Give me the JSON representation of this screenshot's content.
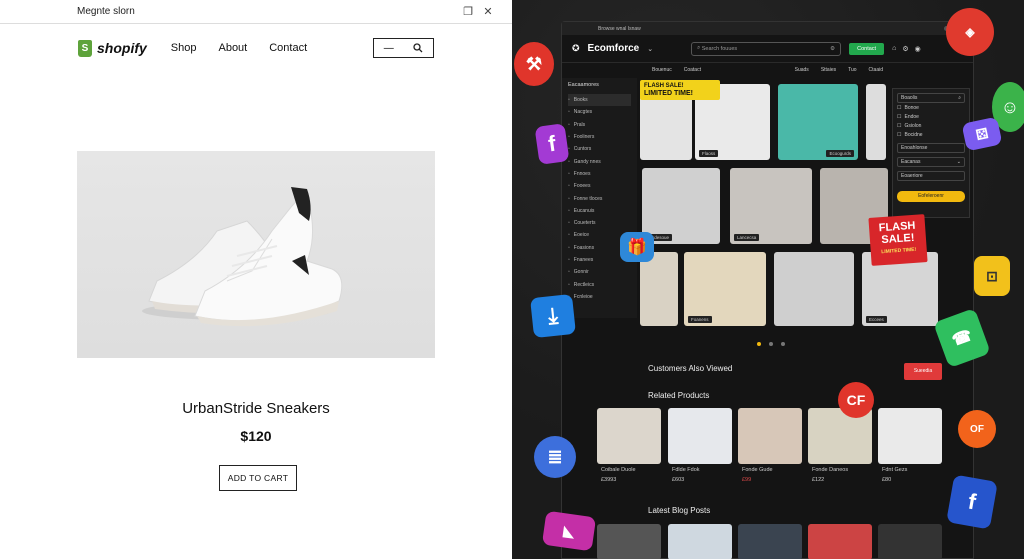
{
  "left": {
    "window_title": "Megnte slorn",
    "brand": "shopify",
    "nav": [
      "Shop",
      "About",
      "Contact"
    ],
    "product_name": "UrbanStride Sneakers",
    "price": "$120",
    "cart_button": "ADD TO CART"
  },
  "right": {
    "tab_title": "Browse wnal Isnaw",
    "brand": "Ecomforce",
    "search_placeholder": "Search fouues",
    "green_button": "Contact",
    "subnav_left": [
      "Bouenuc",
      "Coatact"
    ],
    "subnav_right": [
      "Suads",
      "Sttaies",
      "Tuo",
      "Ctaaid"
    ],
    "banner_line1": "FLASH SALE!",
    "banner_line2": "LIMITED TIME!",
    "sidebar_title": "Eacaamores",
    "sidebar_items": [
      "Books",
      "Nacgtes",
      "Prals",
      "Fooliners",
      "Cuntors",
      "Gandy nnes",
      "Fnnoes",
      "Fooees",
      "Fonne tloces",
      "Eucanuis",
      "Coueterts",
      "Eoeice",
      "Foasions",
      "Fnanees",
      "Gonnir",
      "Rectleics",
      "Fcnleioe"
    ],
    "tile_labels": [
      "Flaoss",
      "Ecoogurds",
      "Ecdesoue",
      "Lancecsa",
      "Foanens",
      "Eccees"
    ],
    "filter_search": "Boaolis",
    "filter_checks": [
      "Bonoe",
      "Endoe",
      "Gsiolon",
      "Bocidne"
    ],
    "filter_selects": [
      "Enoahlonse",
      "Eacanas",
      "Eoaeriore"
    ],
    "filter_button": "Eofeleroenr",
    "section_also": "Customers Also Viewed",
    "red_button": "Sueedia",
    "section_related": "Related Products",
    "related": [
      {
        "name": "Coibale Duole",
        "price": "£3993"
      },
      {
        "name": "Fdlde Fdok",
        "price": "£603"
      },
      {
        "name": "Fonde Gude",
        "price": "£99"
      },
      {
        "name": "Fonde Daneos",
        "price": "£122"
      },
      {
        "name": "Fdnt Gezs",
        "price": "£80"
      }
    ],
    "section_blog": "Latest Blog Posts",
    "flash_sticker": "FLASH SALE!",
    "flash_sticker_sub": "LIMITED TIME!",
    "sticker_cf": "CF",
    "sticker_of": "OF"
  }
}
